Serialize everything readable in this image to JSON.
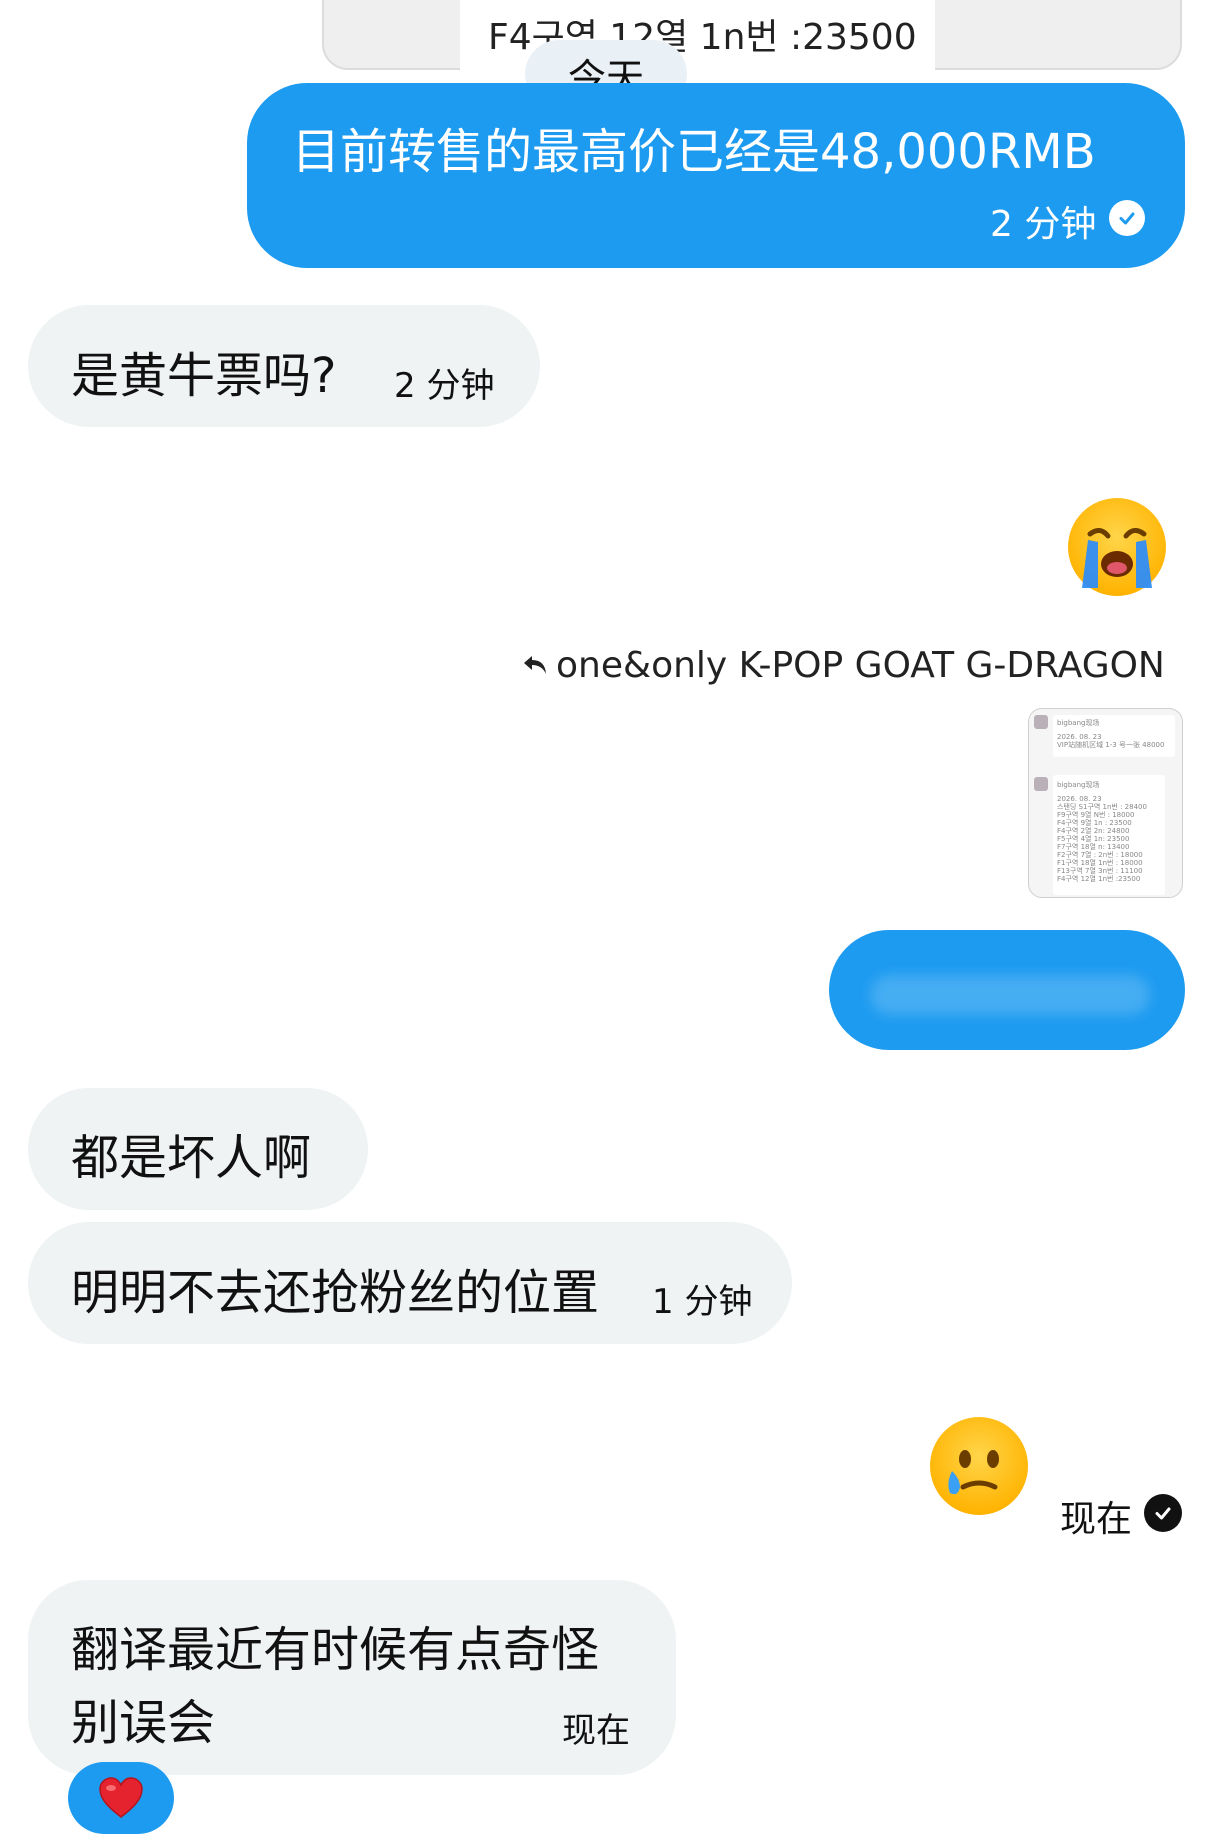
{
  "quoted_preview": {
    "text": "F4구역 12열 1n번 :23500"
  },
  "date_divider": "今天",
  "messages": [
    {
      "id": "m1",
      "side": "out",
      "text": "目前转售的最高价已经是48,000RMB",
      "time": "2 分钟",
      "read": true
    },
    {
      "id": "m2",
      "side": "in",
      "text": "是黄牛票吗?",
      "time": "2 分钟"
    },
    {
      "id": "m3",
      "side": "out",
      "emoji": "loudly-crying-face"
    },
    {
      "id": "m4",
      "side": "out",
      "reply_to": "one&only K-POP GOAT G-DRAGON"
    },
    {
      "id": "m5",
      "side": "out",
      "text": ""
    },
    {
      "id": "m6",
      "side": "in",
      "text": "都是坏人啊"
    },
    {
      "id": "m7",
      "side": "in",
      "text": "明明不去还抢粉丝的位置",
      "time": "1 分钟"
    },
    {
      "id": "m8",
      "side": "out",
      "emoji": "face-holding-back-tears",
      "time": "现在",
      "read": true
    },
    {
      "id": "m9",
      "side": "in",
      "line1": "翻译最近有时候有点奇怪",
      "line2": "别误会",
      "time": "现在",
      "reaction": "red-heart"
    }
  ],
  "thumbnail": {
    "title1": "bigbang现场",
    "date1": "2026. 08. 23",
    "line1": "VIP站随机区域 1-3 号一张 48000",
    "title2": "bigbang现场",
    "date2": "2026. 08. 23",
    "rows": [
      "스탠딩 S1구역 1n번 : 28400",
      "F9구역 9열 N번 : 18000",
      "F4구역 9열 1n : 23500",
      "F4구역 2열 2n: 24800",
      "F5구역 4열 1n: 23500",
      "F7구역 18열 n: 13400",
      "F2구역 7열 : 2n번 : 18000",
      "F1구역 18열 1n번 : 18000",
      "F13구역 7열 3n번 : 11100",
      "F4구역 12열 1n번 :23500"
    ]
  },
  "colors": {
    "outgoing_bubble": "#1d9bf0",
    "incoming_bubble": "#eff3f4",
    "background": "#ffffff"
  }
}
